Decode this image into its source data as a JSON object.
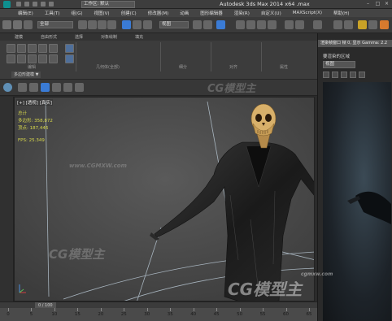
{
  "titlebar": {
    "workspace": "工作区: 默认",
    "title": "Autodesk 3ds Max  2014 x64    .max"
  },
  "menu": [
    "编辑(E)",
    "工具(T)",
    "组(G)",
    "视图(V)",
    "创建(C)",
    "修改器(M)",
    "动画",
    "图形编辑器",
    "渲染(R)",
    "自定义(U)",
    "MAXScript(X)",
    "帮助(H)"
  ],
  "toolbar": {
    "selection_set": "全部",
    "reference_coord": "视图"
  },
  "ribbon": {
    "tabs": [
      "建模",
      "自由形式",
      "选择",
      "对象绘制",
      "填充"
    ],
    "groups": [
      "编辑",
      "几何体(全部)",
      "细分",
      "对齐",
      "属性"
    ],
    "poly_modeling": "多边形建模 ▼"
  },
  "viewport": {
    "label": "[+] [透视] [真实]",
    "stats": [
      {
        "label": "总计",
        "value": ""
      },
      {
        "label": "多边形",
        "value": "358,872"
      },
      {
        "label": "顶点",
        "value": "187,446"
      },
      {
        "label": "FPS",
        "value": "25.349"
      }
    ]
  },
  "render_panel": {
    "header": "渲染帧窗口 帧 0, 显示 Gamma: 2.2",
    "label": "要渲染的区域",
    "area": "视图"
  },
  "timeline": {
    "frames": "0 / 100",
    "ticks": [
      "0",
      "5",
      "10",
      "15",
      "20",
      "25",
      "30",
      "35",
      "40",
      "45",
      "50",
      "55",
      "60",
      "65"
    ]
  },
  "watermarks": [
    "CG模型主",
    "www.CGMXW.com",
    "CG模型主",
    "cgmxw.com"
  ]
}
